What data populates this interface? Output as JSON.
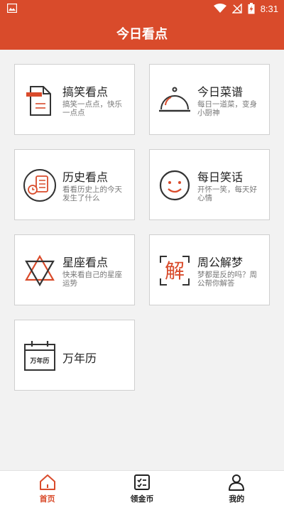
{
  "status_bar": {
    "time": "8:31"
  },
  "header": {
    "title": "今日看点"
  },
  "cards": [
    {
      "title": "搞笑看点",
      "desc": "搞笑一点点，快乐一点点",
      "icon": "news-paper-icon"
    },
    {
      "title": "今日菜谱",
      "desc": "每日一道菜，变身小厨神",
      "icon": "food-cloche-icon"
    },
    {
      "title": "历史看点",
      "desc": "看看历史上的今天发生了什么",
      "icon": "history-clock-icon"
    },
    {
      "title": "每日笑话",
      "desc": "开怀一笑，每天好心情",
      "icon": "smiley-face-icon"
    },
    {
      "title": "星座看点",
      "desc": "快来看自己的星座运势",
      "icon": "star-of-david-icon"
    },
    {
      "title": "周公解梦",
      "desc": "梦都是反的吗？周公帮你解答",
      "icon": "dream-interpret-icon",
      "icon_char": "解"
    },
    {
      "title": "万年历",
      "desc": "",
      "icon": "calendar-icon",
      "icon_text": "万年历"
    }
  ],
  "bottom_nav": [
    {
      "label": "首页",
      "icon": "home-icon",
      "active": true
    },
    {
      "label": "领金币",
      "icon": "checklist-icon",
      "active": false
    },
    {
      "label": "我的",
      "icon": "user-icon",
      "active": false
    }
  ],
  "colors": {
    "accent": "#d94b2b",
    "card_border": "#cfcfcf",
    "background": "#f2f2f2"
  }
}
